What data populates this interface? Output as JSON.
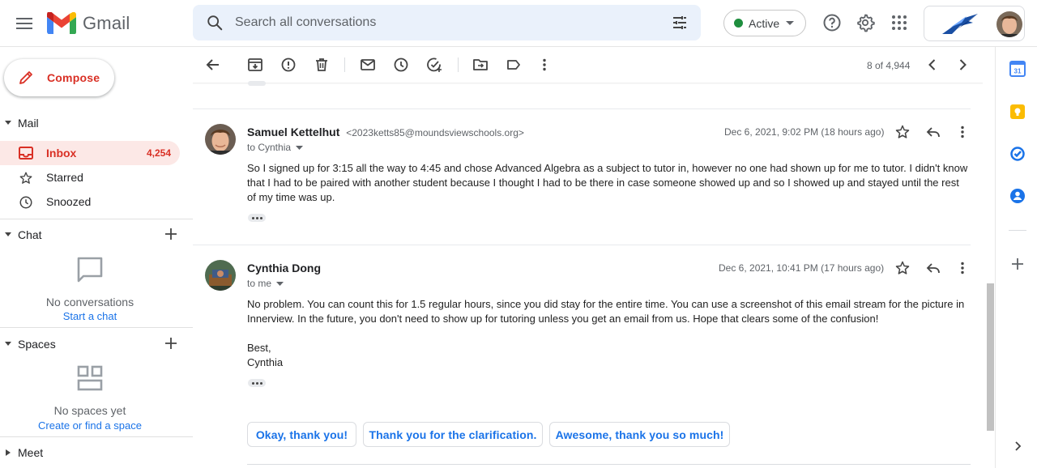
{
  "header": {
    "app_name": "Gmail",
    "search_placeholder": "Search all conversations",
    "status_label": "Active",
    "colors": {
      "status_dot": "#1e8e3e",
      "search_bg": "#eaf1fb",
      "accent_red": "#d93025",
      "link_blue": "#1a73e8"
    },
    "icons": [
      "menu-icon",
      "gmail-logo",
      "search-icon",
      "tune-icon",
      "help-icon",
      "settings-icon",
      "apps-icon",
      "organization-logo",
      "account-avatar"
    ]
  },
  "compose": {
    "label": "Compose"
  },
  "nav": {
    "mail_title": "Mail",
    "items": [
      {
        "label": "Inbox",
        "count": "4,254",
        "icon": "inbox-icon",
        "active": true
      },
      {
        "label": "Starred",
        "count": "",
        "icon": "star-icon",
        "active": false
      },
      {
        "label": "Snoozed",
        "count": "",
        "icon": "clock-icon",
        "active": false
      }
    ],
    "chat": {
      "title": "Chat",
      "empty_text": "No conversations",
      "link": "Start a chat"
    },
    "spaces": {
      "title": "Spaces",
      "empty_text": "No spaces yet",
      "link": "Create or find a space"
    },
    "meet": {
      "title": "Meet"
    }
  },
  "toolbar": {
    "icons": [
      "back-icon",
      "archive-icon",
      "report-spam-icon",
      "delete-icon",
      "mark-unread-icon",
      "snooze-icon",
      "add-to-tasks-icon",
      "move-to-icon",
      "label-icon",
      "more-icon"
    ],
    "pager": "8 of 4,944"
  },
  "messages": [
    {
      "sender": "Samuel Kettelhut",
      "email": "<2023ketts85@moundsviewschools.org>",
      "date": "Dec 6, 2021, 9:02 PM (18 hours ago)",
      "to": "to Cynthia",
      "body": "So I signed up for 3:15 all the way to 4:45 and chose Advanced Algebra as a subject to tutor in, however no one had shown up for me to tutor. I didn't know that I had to be paired with another student because I thought I had to be there in case someone showed up and so I showed up and stayed until the rest of my time was up."
    },
    {
      "sender": "Cynthia Dong",
      "email": "",
      "date": "Dec 6, 2021, 10:41 PM (17 hours ago)",
      "to": "to me",
      "body": "No problem. You can count this for 1.5 regular hours, since you did stay for the entire time. You can use a screenshot of this email stream for the picture in Innerview. In the future, you don't need to show up for tutoring unless you get an email from us. Hope that clears some of the confusion!",
      "closing": "Best,",
      "signature": "Cynthia"
    }
  ],
  "smart_replies": [
    "Okay, thank you!",
    "Thank you for the clarification.",
    "Awesome, thank you so much!"
  ],
  "side_panel": {
    "icons": [
      "calendar-icon",
      "keep-icon",
      "tasks-icon",
      "contacts-icon",
      "add-addon-icon",
      "expand-panel-icon"
    ],
    "calendar_day": "31"
  }
}
